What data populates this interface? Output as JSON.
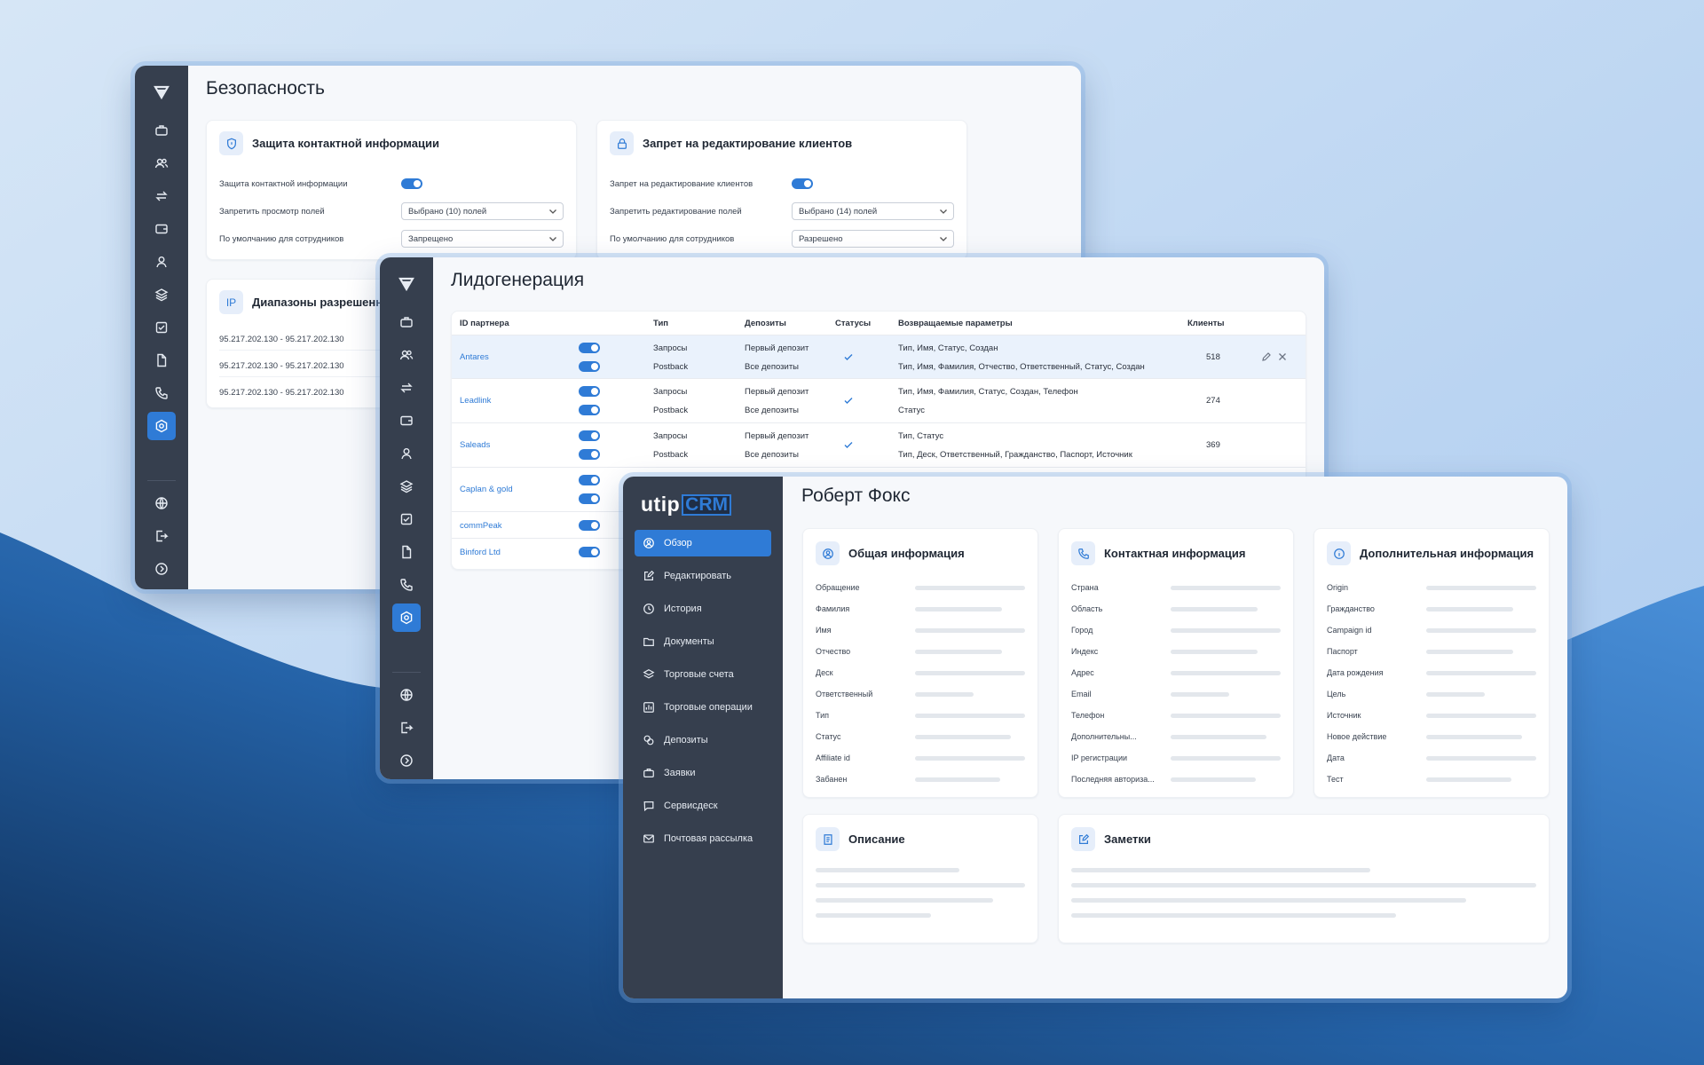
{
  "security": {
    "title": "Безопасность",
    "contact_protection": {
      "title": "Защита контактной информации",
      "rows": [
        {
          "label": "Защита контактной информации"
        },
        {
          "label": "Запретить просмотр полей",
          "value": "Выбрано (10) полей"
        },
        {
          "label": "По умолчанию для сотрудников",
          "value": "Запрещено"
        }
      ]
    },
    "edit_ban": {
      "title": "Запрет на редактирование клиентов",
      "rows": [
        {
          "label": "Запрет на редактирование клиентов"
        },
        {
          "label": "Запретить редактирование полей",
          "value": "Выбрано (14) полей"
        },
        {
          "label": "По умолчанию для сотрудников",
          "value": "Разрешено"
        }
      ]
    },
    "ip_ranges": {
      "icon_text": "IP",
      "title": "Диапазоны разрешенн",
      "items": [
        "95.217.202.130 - 95.217.202.130",
        "95.217.202.130 - 95.217.202.130",
        "95.217.202.130 - 95.217.202.130"
      ]
    }
  },
  "leadgen": {
    "title": "Лидогенерация",
    "columns": [
      "ID партнера",
      "Тип",
      "Депозиты",
      "Статусы",
      "Возвращаемые параметры",
      "Клиенты"
    ],
    "rows": [
      {
        "partner": "Antares",
        "type1": "Запросы",
        "type2": "Postback",
        "dep1": "Первый депозит",
        "dep2": "Все депозиты",
        "params1": "Тип, Имя, Статус, Создан",
        "params2": "Тип, Имя, Фамилия, Отчество, Ответственный, Статус, Создан",
        "clients": "518"
      },
      {
        "partner": "Leadlink",
        "type1": "Запросы",
        "type2": "Postback",
        "dep1": "Первый депозит",
        "dep2": "Все депозиты",
        "params1": "Тип, Имя, Фамилия, Статус, Создан, Телефон",
        "params2": "Статус",
        "clients": "274"
      },
      {
        "partner": "Saleads",
        "type1": "Запросы",
        "type2": "Postback",
        "dep1": "Первый депозит",
        "dep2": "Все депозиты",
        "params1": "Тип, Статус",
        "params2": "Тип, Деск, Ответственный, Гражданство, Паспорт, Источник",
        "clients": "369"
      },
      {
        "partner": "Caplan & gold"
      },
      {
        "partner": "commPeak"
      },
      {
        "partner": "Binford Ltd"
      }
    ]
  },
  "crm": {
    "logo_text": "utip",
    "logo_badge": "CRM",
    "client_name": "Роберт Фокс",
    "menu": [
      "Обзор",
      "Редактировать",
      "История",
      "Документы",
      "Торговые счета",
      "Торговые операции",
      "Депозиты",
      "Заявки",
      "Сервисдеск",
      "Почтовая рассылка"
    ],
    "general": {
      "title": "Общая информация",
      "fields": [
        "Обращение",
        "Фамилия",
        "Имя",
        "Отчество",
        "Деск",
        "Ответственный",
        "Тип",
        "Статус",
        "Affiliate id",
        "Забанен"
      ]
    },
    "contact": {
      "title": "Контактная информация",
      "fields": [
        "Страна",
        "Область",
        "Город",
        "Индекс",
        "Адрес",
        "Email",
        "Телефон",
        "Дополнительны...",
        "IP регистрации",
        "Последняя авториза..."
      ]
    },
    "extra": {
      "title": "Дополнительная информация",
      "fields": [
        "Origin",
        "Гражданство",
        "Campaign id",
        "Паспорт",
        "Дата рождения",
        "Цель",
        "Источник",
        "Новое действие",
        "Дата",
        "Тест"
      ]
    },
    "description": {
      "title": "Описание"
    },
    "notes": {
      "title": "Заметки"
    }
  },
  "colors": {
    "accent": "#2f7bd6",
    "sidebar": "#363f4e",
    "page_bg": "#c6dcf3"
  }
}
